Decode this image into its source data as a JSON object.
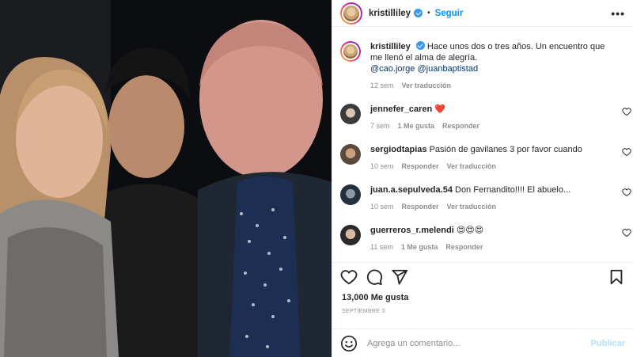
{
  "post": {
    "author": "kristilliley",
    "follow_label": "Seguir",
    "more_label": "•••",
    "caption_text": "Hace unos dos o tres años. Un encuentro que me llenó el alma de alegría.",
    "mentions": "@cao.jorge @juanbaptistad",
    "caption_time": "12 sem",
    "caption_translate": "Ver traducción",
    "photo_alt": "Selfie of three people at night",
    "likes": "13,000 Me gusta",
    "date": "SEPTIEMBRE 3"
  },
  "comments": [
    {
      "user": "jennefer_caren",
      "text": "",
      "emoji": "❤️",
      "time": "7 sem",
      "likes": "1 Me gusta",
      "reply": "Responder",
      "translate": ""
    },
    {
      "user": "sergiodtapias",
      "text": "Pasión de gavilanes 3 por favor cuando",
      "emoji": "",
      "time": "10 sem",
      "likes": "",
      "reply": "Responder",
      "translate": "Ver traducción"
    },
    {
      "user": "juan.a.sepulveda.54",
      "text": "Don Fernandito!!!! El abuelo...",
      "emoji": "",
      "time": "10 sem",
      "likes": "",
      "reply": "Responder",
      "translate": "Ver traducción"
    },
    {
      "user": "guerreros_r.melendi",
      "text": "",
      "emoji": "😍😍😍",
      "time": "11 sem",
      "likes": "1 Me gusta",
      "reply": "Responder",
      "translate": ""
    }
  ],
  "add_comment": {
    "placeholder": "Agrega un comentario...",
    "publish_label": "Publicar"
  },
  "icons": {
    "like": "heart-icon",
    "comment": "comment-bubble-icon",
    "share": "paper-plane-icon",
    "save": "bookmark-icon",
    "emoji": "smiley-icon",
    "verified": "verified-badge-icon"
  },
  "colors": {
    "accent": "#0095f6",
    "publish_disabled": "#b2dffc",
    "meta": "#8e8e8e",
    "heart_red": "#ed4956"
  }
}
